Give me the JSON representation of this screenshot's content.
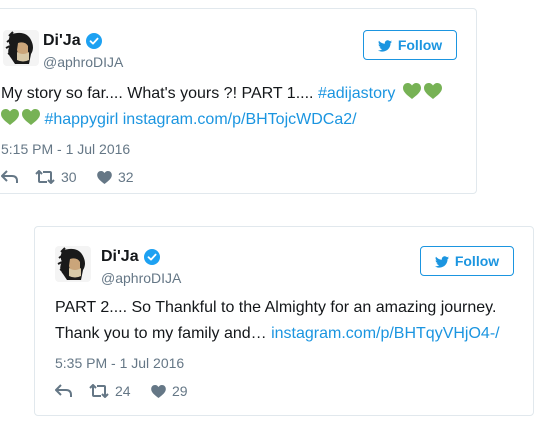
{
  "tweets": [
    {
      "display_name": "Di'Ja",
      "handle": "@aphroDIJA",
      "follow_label": "Follow",
      "text_line1": "My story so far.... What's yours ?! PART 1.... ",
      "hashtag1": "#adijastory",
      "hashtag2": "#happygirl",
      "link": "instagram.com/p/BHTojcWDCa2/",
      "timestamp": "5:15 PM - 1 Jul 2016",
      "retweets": "30",
      "likes": "32"
    },
    {
      "display_name": "Di'Ja",
      "handle": "@aphroDIJA",
      "follow_label": "Follow",
      "text_line1": "PART 2.... So Thankful to the Almighty for an amazing journey.",
      "text_line2": "Thank you to my family and… ",
      "link": "instagram.com/p/BHTqyVHjO4-/",
      "timestamp": "5:35 PM - 1 Jul 2016",
      "retweets": "24",
      "likes": "29"
    }
  ],
  "icons": {
    "verified": "verified-badge-icon",
    "bird": "twitter-bird-icon",
    "reply": "reply-icon",
    "retweet": "retweet-icon",
    "like": "heart-icon",
    "emoji": "green-heart-emoji"
  },
  "colors": {
    "accent": "#1b95e0",
    "muted": "#657786",
    "text": "#14171a",
    "border": "#e1e8ed",
    "emoji_green": "#77b255"
  }
}
